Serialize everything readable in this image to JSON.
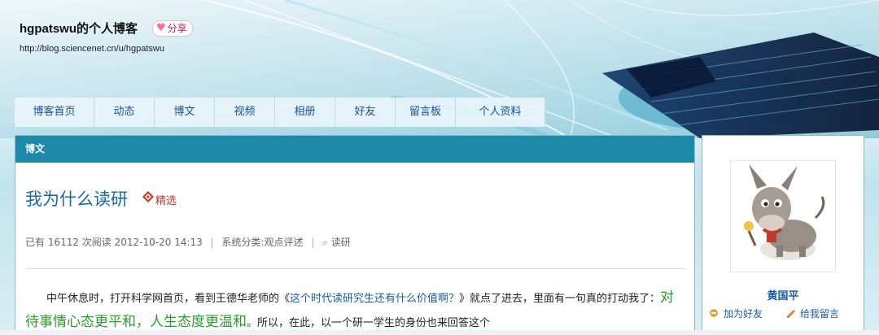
{
  "header": {
    "blog_title": "hgpatswu的个人博客",
    "share_label": "分享",
    "blog_url": "http://blog.sciencenet.cn/u/hgpatswu"
  },
  "nav": {
    "items": [
      {
        "label": "博客首页"
      },
      {
        "label": "动态"
      },
      {
        "label": "博文"
      },
      {
        "label": "视频"
      },
      {
        "label": "相册"
      },
      {
        "label": "好友"
      },
      {
        "label": "留言板"
      },
      {
        "label": "个人资料"
      }
    ]
  },
  "main": {
    "section_title": "博文",
    "post_title": "我为什么读研",
    "badge": "精选",
    "meta": {
      "read_count": "已有 16112 次阅读",
      "date": "2012-10-20 14:13",
      "category": "系统分类:观点评述",
      "tag": "读研"
    },
    "para": {
      "before_link": "中午休息时，打开科学网首页，看到王德华老师的《",
      "link": "这个时代读研究生还有什么价值啊？",
      "after_link": "》就点了进去，里面有一句真的打动我了：",
      "highlight": "对待事情心态更平和，人生态度更温和",
      "after_highlight": "。所以，在此，以一个研一学生的身份也来回答这个"
    }
  },
  "side": {
    "user_name": "黄国平",
    "add_friend": "加为好友",
    "message": "给我留言"
  },
  "colors": {
    "accent_bar": "#1c8aa8",
    "link": "#1a5ca8",
    "highlight": "#2e9b2e",
    "badge": "#c0392b"
  },
  "icons": [
    "heart-icon",
    "featured-icon",
    "tag-icon",
    "add-friend-icon",
    "pencil-icon",
    "donkey-avatar"
  ]
}
